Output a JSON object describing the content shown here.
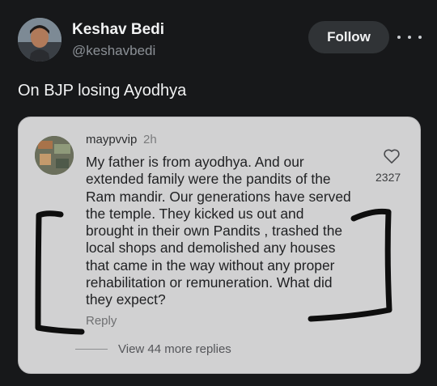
{
  "author": {
    "name": "Keshav Bedi",
    "handle": "@keshavbedi"
  },
  "header": {
    "follow_label": "Follow",
    "more_icon": "more-dots-icon"
  },
  "tweet": {
    "text": "On BJP losing Ayodhya"
  },
  "quoted_comment": {
    "username": "maypvvip",
    "time": "2h",
    "lines": [
      "My father is from ayodhya. And our",
      "extended family were the pandits of the",
      "Ram mandir. Our generations have served",
      "the temple. They kicked us out and",
      "brought in their own Pandits , trashed the",
      "local shops and demolished any houses",
      "that came in the way without any proper",
      "rehabilitation or remuneration. What did",
      "they expect?"
    ],
    "likes": "2327",
    "like_icon": "heart-icon",
    "reply_label": "Reply",
    "view_replies_label": "View 44 more replies"
  },
  "colors": {
    "background": "#17181a",
    "card": "#d1d1d2",
    "follow_bg": "#303336",
    "annotation": "#0e0e0e"
  }
}
